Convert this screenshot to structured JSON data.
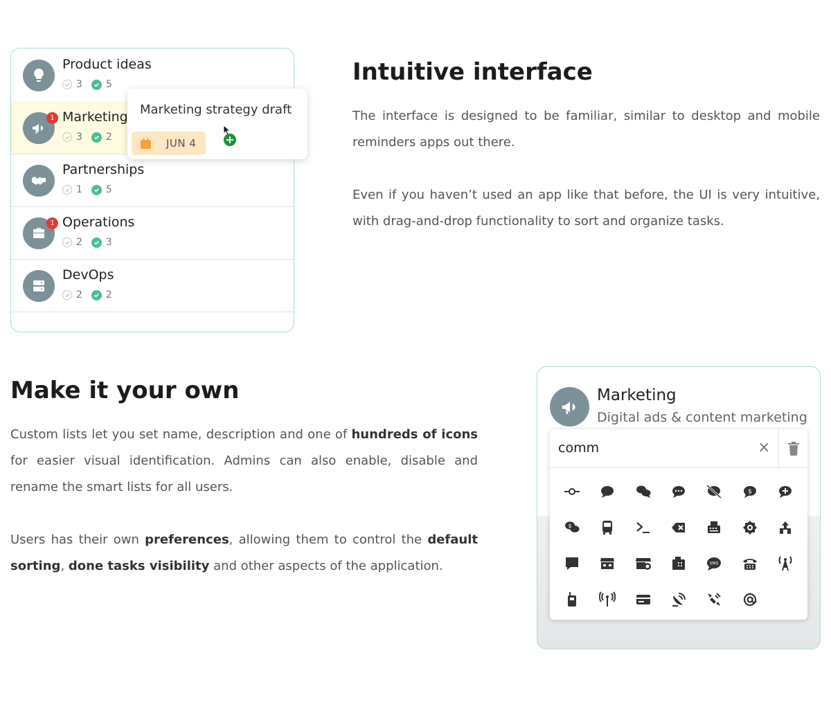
{
  "lists": [
    {
      "name": "Product ideas",
      "icon": "lightbulb-icon",
      "open": "3",
      "done": "5",
      "badge": "",
      "highlight": false
    },
    {
      "name": "Marketing",
      "icon": "megaphone-icon",
      "open": "3",
      "done": "2",
      "badge": "1",
      "highlight": true
    },
    {
      "name": "Partnerships",
      "icon": "handshake-icon",
      "open": "1",
      "done": "5",
      "badge": "",
      "highlight": false
    },
    {
      "name": "Operations",
      "icon": "briefcase-icon",
      "open": "2",
      "done": "3",
      "badge": "1",
      "highlight": false
    },
    {
      "name": "DevOps",
      "icon": "server-icon",
      "open": "2",
      "done": "2",
      "badge": "",
      "highlight": false
    }
  ],
  "drag_task": {
    "title": "Marketing strategy draft",
    "date": "JUN 4"
  },
  "section1": {
    "heading": "Intuitive interface",
    "p1": "The interface is designed to be familiar, similar to desktop and mobile reminders apps out there.",
    "p2": "Even if you haven’t used an app like that before, the UI is very intuitive, with drag-and-drop functionality to sort and organize tasks."
  },
  "section2": {
    "heading": "Make it your own",
    "p1_a": "Custom lists let you set name, description and one of ",
    "p1_b": "hundreds of icons",
    "p1_c": " for easier visual identification. Admins can also enable, disable and rename the smart lists for all users.",
    "p2_a": "Users has their own ",
    "p2_b": "preferences",
    "p2_c": ", allowing them to control the ",
    "p2_d": "default sorting",
    "p2_e": ", ",
    "p2_f": "done tasks visibility",
    "p2_g": " and other aspects of the application."
  },
  "icon_picker": {
    "list_name": "Marketing",
    "list_description": "Digital ads & content marketing",
    "search_value": "comm",
    "clear_label": "×",
    "icons": [
      "commit-icon",
      "comment-icon",
      "comments-icon",
      "comment-dots-icon",
      "comment-slash-icon",
      "comment-dollar-icon",
      "comment-medical-icon",
      "comments-dollar-icon",
      "bus-icon",
      "terminal-icon",
      "backspace-icon",
      "fax-icon",
      "compact-disc-icon",
      "sitemap-icon",
      "comment-alt-icon",
      "store-icon",
      "store-alt-icon",
      "fax-machine-icon",
      "sms-icon",
      "phone-office-icon",
      "broadcast-tower-icon",
      "walkie-talkie-icon",
      "antenna-icon",
      "id-card-icon",
      "satellite-dish-icon",
      "satellite-icon",
      "at-icon"
    ]
  }
}
